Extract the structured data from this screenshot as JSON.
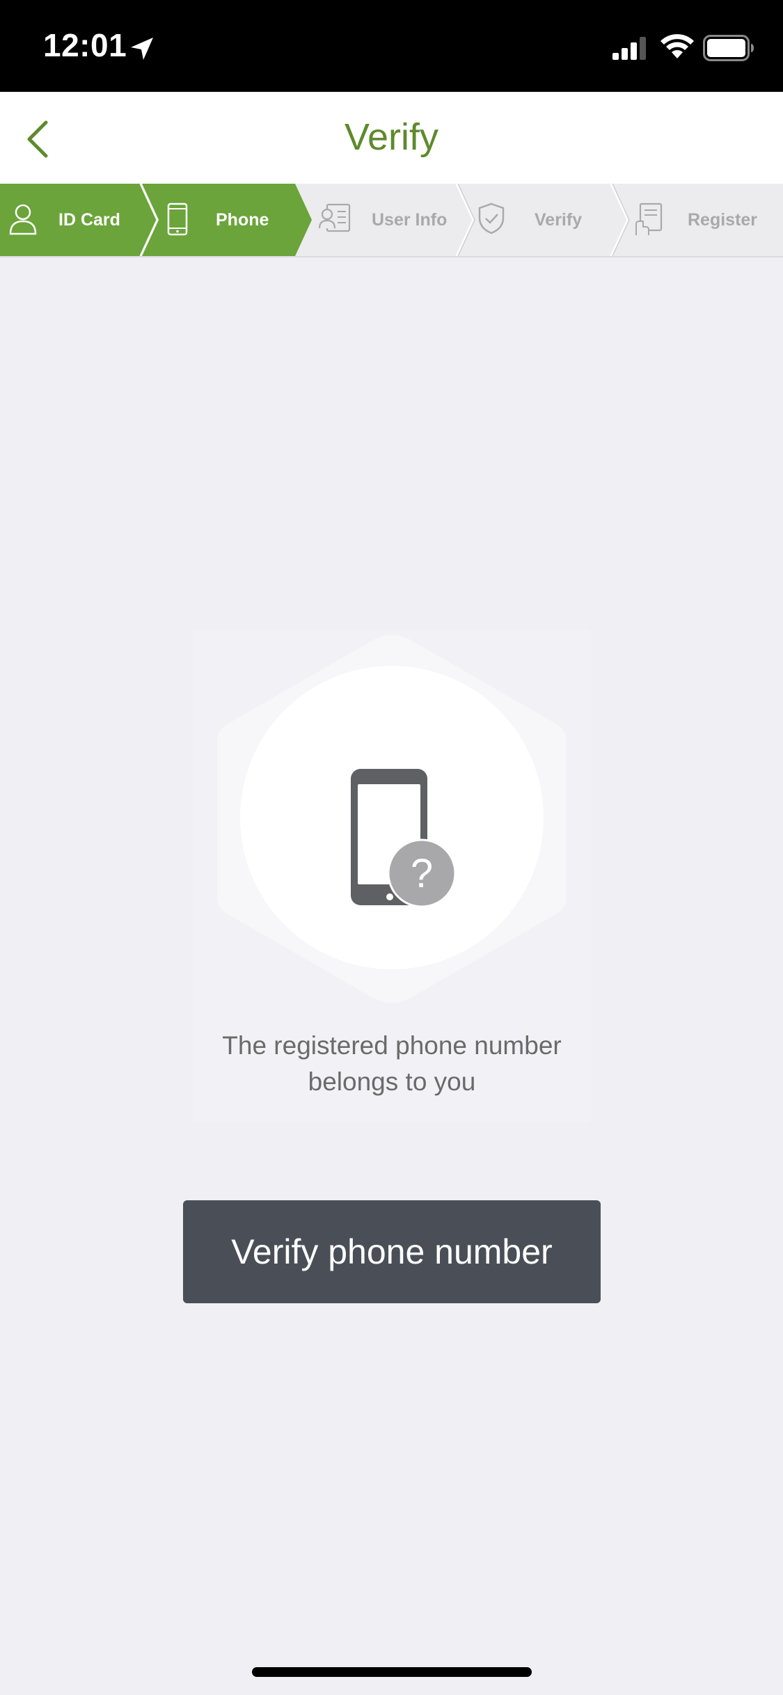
{
  "status_bar": {
    "time": "12:01",
    "icons": [
      "location-arrow-icon",
      "cellular-signal-icon",
      "wifi-icon",
      "battery-icon"
    ]
  },
  "nav": {
    "title": "Verify",
    "back_icon": "chevron-left-icon"
  },
  "steps": [
    {
      "label": "ID Card",
      "icon": "person-icon",
      "state": "completed"
    },
    {
      "label": "Phone",
      "icon": "phone-icon",
      "state": "current"
    },
    {
      "label": "User Info",
      "icon": "id-card-icon",
      "state": "pending"
    },
    {
      "label": "Verify",
      "icon": "shield-check-icon",
      "state": "pending"
    },
    {
      "label": "Register",
      "icon": "document-sign-icon",
      "state": "pending"
    }
  ],
  "card": {
    "icon": "phone-question-icon",
    "text_line1": "The registered phone number",
    "text_line2": "belongs to you"
  },
  "button": {
    "label": "Verify phone number"
  },
  "colors": {
    "accent_green": "#6aa43a",
    "title_green": "#5e8a2c",
    "button_dark": "#4a4f57",
    "background": "#efeff4"
  }
}
